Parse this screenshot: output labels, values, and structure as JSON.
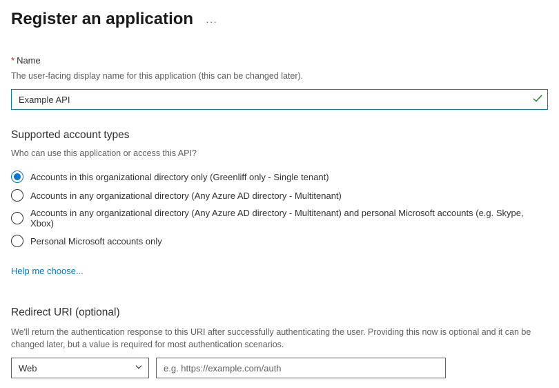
{
  "header": {
    "title": "Register an application"
  },
  "name_field": {
    "label": "Name",
    "required_marker": "*",
    "help": "The user-facing display name for this application (this can be changed later).",
    "value": "Example API"
  },
  "account_types": {
    "title": "Supported account types",
    "subtitle": "Who can use this application or access this API?",
    "options": [
      {
        "label": "Accounts in this organizational directory only (Greenliff only - Single tenant)",
        "selected": true
      },
      {
        "label": "Accounts in any organizational directory (Any Azure AD directory - Multitenant)",
        "selected": false
      },
      {
        "label": "Accounts in any organizational directory (Any Azure AD directory - Multitenant) and personal Microsoft accounts (e.g. Skype, Xbox)",
        "selected": false
      },
      {
        "label": "Personal Microsoft accounts only",
        "selected": false
      }
    ],
    "help_link": "Help me choose..."
  },
  "redirect": {
    "title": "Redirect URI (optional)",
    "help": "We'll return the authentication response to this URI after successfully authenticating the user. Providing this now is optional and it can be changed later, but a value is required for most authentication scenarios.",
    "platform_value": "Web",
    "uri_placeholder": "e.g. https://example.com/auth",
    "uri_value": ""
  }
}
